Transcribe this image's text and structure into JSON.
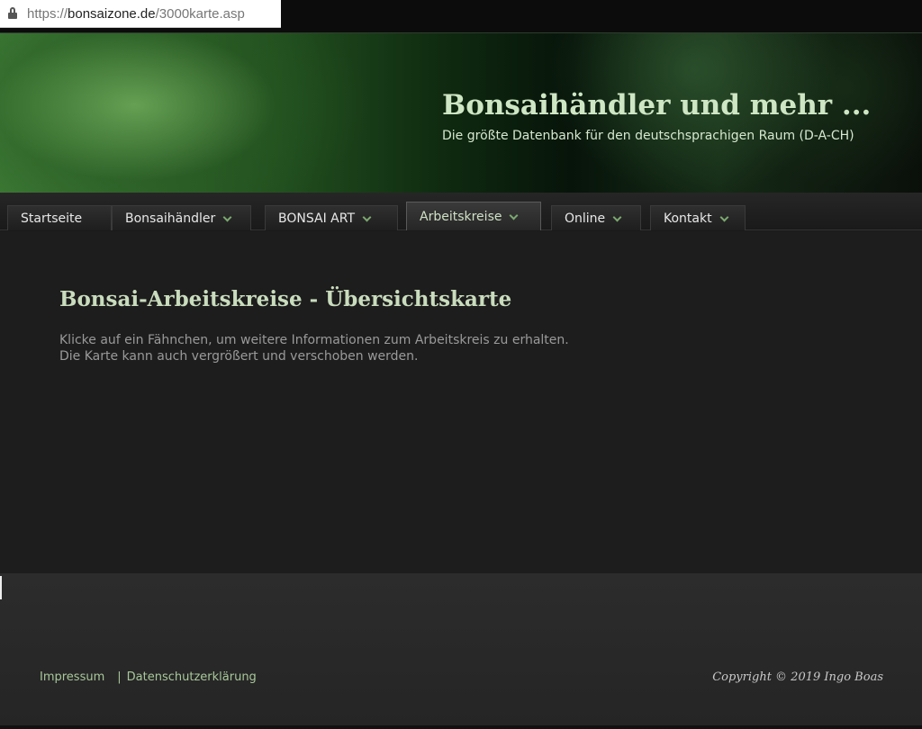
{
  "browser": {
    "url_prefix": "https://",
    "url_host": "bonsaizone.de",
    "url_path": "/3000karte.asp"
  },
  "header": {
    "title": "Bonsaihändler und mehr ...",
    "subtitle": "Die größte Datenbank für den deutschsprachigen Raum (D-A-CH)"
  },
  "nav": {
    "items": [
      {
        "label": "Startseite"
      },
      {
        "label": "Bonsaihändler"
      },
      {
        "label": "BONSAI ART"
      },
      {
        "label": "Arbeitskreise"
      },
      {
        "label": "Online"
      },
      {
        "label": "Kontakt"
      }
    ],
    "active": "Arbeitskreise"
  },
  "main": {
    "title": "Bonsai-Arbeitskreise - Übersichtskarte",
    "intro": "Klicke auf ein Fähnchen, um weitere Informationen zum Arbeitskreis zu erhalten. Die Karte kann auch vergrößert und verschoben werden."
  },
  "footer": {
    "impressum": "Impressum",
    "separator": "|",
    "datenschutz": "Datenschutzerklärung",
    "copyright": "Copyright © 2019 Ingo Boas"
  },
  "colors": {
    "accent": "#c9dcbd",
    "background": "#1d1d1d",
    "link": "#a8c89a"
  }
}
